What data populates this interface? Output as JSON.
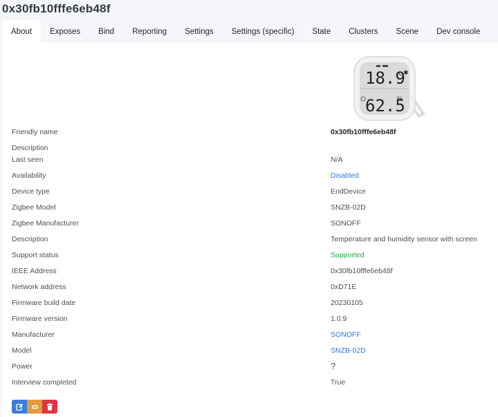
{
  "page": {
    "title": "0x30fb10fffe6eb48f"
  },
  "tabs": [
    {
      "label": "About",
      "active": true
    },
    {
      "label": "Exposes"
    },
    {
      "label": "Bind"
    },
    {
      "label": "Reporting"
    },
    {
      "label": "Settings"
    },
    {
      "label": "Settings (specific)"
    },
    {
      "label": "State"
    },
    {
      "label": "Clusters"
    },
    {
      "label": "Scene"
    },
    {
      "label": "Dev console"
    }
  ],
  "device_image": {
    "icon": "temperature-humidity-sensor-image",
    "display_temperature": "18.9",
    "display_humidity": "62.5"
  },
  "about": [
    {
      "label": "Friendly name",
      "value": "0x30fb10fffe6eb48f",
      "style": "bold"
    },
    {
      "label": "Description",
      "value": ""
    },
    {
      "label": "Last seen",
      "value": "N/A"
    },
    {
      "label": "Availability",
      "value": "Disabled",
      "style": "link"
    },
    {
      "label": "Device type",
      "value": "EndDevice"
    },
    {
      "label": "Zigbee Model",
      "value": "SNZB-02D"
    },
    {
      "label": "Zigbee Manufacturer",
      "value": "SONOFF"
    },
    {
      "label": "Description",
      "value": "Temperature and humidity sensor with screen"
    },
    {
      "label": "Support status",
      "value": "Supported",
      "style": "ok"
    },
    {
      "label": "IEEE Address",
      "value": "0x30fb10fffe6eb48f"
    },
    {
      "label": "Network address",
      "value": "0xD71E"
    },
    {
      "label": "Firmware build date",
      "value": "20230105"
    },
    {
      "label": "Firmware version",
      "value": "1.0.9"
    },
    {
      "label": "Manufacturer",
      "value": "SONOFF",
      "style": "link"
    },
    {
      "label": "Model",
      "value": "SNZB-02D",
      "style": "link"
    },
    {
      "label": "Power",
      "value": "?",
      "style": "q"
    },
    {
      "label": "Interview completed",
      "value": "True"
    }
  ],
  "actions": {
    "edit_icon": "edit-icon",
    "rename_icon": "rename-icon",
    "delete_icon": "trash-icon",
    "colors": {
      "edit": "#3b7ddd",
      "rename": "#e69a3a",
      "delete": "#dc3545"
    }
  }
}
